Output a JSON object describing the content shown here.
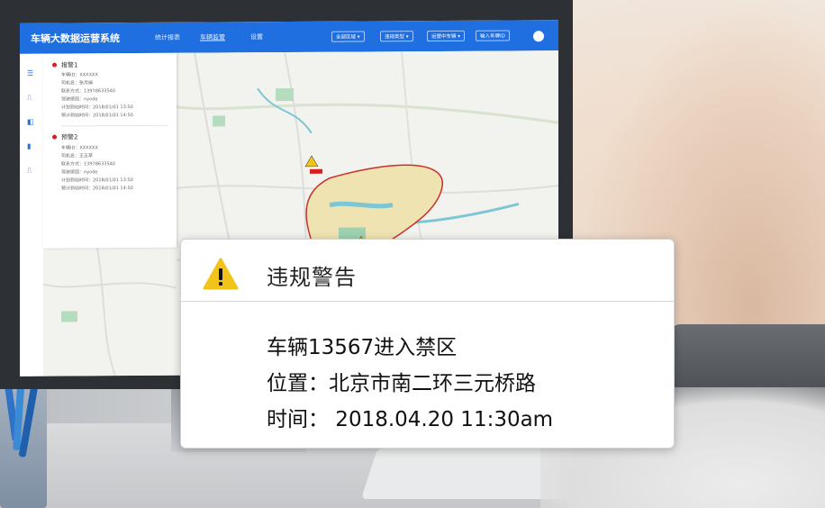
{
  "app": {
    "title": "车辆大数据运营系统",
    "nav": [
      "统计报表",
      "车辆监管",
      "设置"
    ],
    "filters": [
      "全部区域 ▾",
      "违规类型 ▾",
      "运营中车辆 ▾",
      "输入车牌ID"
    ]
  },
  "alerts": [
    {
      "title": "报警1",
      "lines": [
        "车辆ID：XXXXXX",
        "司机名：张月娟",
        "联系方式：13978633540",
        "驾驶原因：nyode",
        "计划到站时间：2018/01/01  13:50",
        "预计到站时间：2018/01/01  14:50"
      ]
    },
    {
      "title": "预警2",
      "lines": [
        "车辆ID：XXXXXX",
        "司机名：王五草",
        "联系方式：13978633540",
        "驾驶原因：nyode",
        "计划到站时间：2018/01/01  13:50",
        "预计到站时间：2018/01/01  14:50"
      ]
    }
  ],
  "dialog": {
    "title": "违规警告",
    "vehicle": "车辆13567进入禁区",
    "location": "位置：北京市南二环三元桥路",
    "time": "时间：  2018.04.20   11:30am"
  },
  "colors": {
    "accent": "#1f6fe0",
    "warning": "#f2c318",
    "alarm": "#d62020"
  }
}
